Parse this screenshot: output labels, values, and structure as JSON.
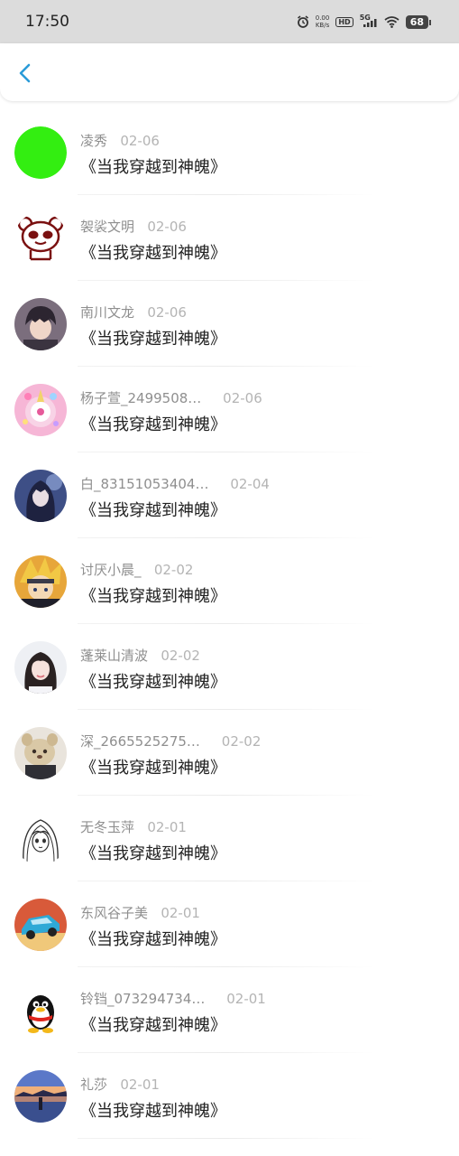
{
  "status_bar": {
    "time": "17:50",
    "net_speed_value": "0.00",
    "net_speed_unit": "KB/s",
    "hd": "HD",
    "network": "5G",
    "battery": "68",
    "icons": [
      "alarm-icon",
      "hd-icon",
      "signal-icon",
      "wifi-icon",
      "battery-icon"
    ]
  },
  "header": {
    "back_icon": "chevron-left-icon",
    "accent_color": "#2a9bd8"
  },
  "list": [
    {
      "name": "凌秀",
      "date": "02-06",
      "book": "《当我穿越到神魄》",
      "avatar": "green-circle"
    },
    {
      "name": "袈裟文明",
      "date": "02-06",
      "book": "《当我穿越到神魄》",
      "avatar": "panda-cartoon"
    },
    {
      "name": "南川文龙",
      "date": "02-06",
      "book": "《当我穿越到神魄》",
      "avatar": "anime-boy"
    },
    {
      "name": "杨子萱_2499508…",
      "date": "02-06",
      "book": "《当我穿越到神魄》",
      "avatar": "pink-unicorn"
    },
    {
      "name": "白_83151053404…",
      "date": "02-04",
      "book": "《当我穿越到神魄》",
      "avatar": "anime-girl-blue"
    },
    {
      "name": "讨厌小晨_",
      "date": "02-02",
      "book": "《当我穿越到神魄》",
      "avatar": "anime-orange"
    },
    {
      "name": "蓬莱山清波",
      "date": "02-02",
      "book": "《当我穿越到神魄》",
      "avatar": "girl-photo"
    },
    {
      "name": "深_2665525275…",
      "date": "02-02",
      "book": "《当我穿越到神魄》",
      "avatar": "plush-toy"
    },
    {
      "name": "无冬玉萍",
      "date": "02-01",
      "book": "《当我穿越到神魄》",
      "avatar": "sketch-girl"
    },
    {
      "name": "东风谷子美",
      "date": "02-01",
      "book": "《当我穿越到神魄》",
      "avatar": "blue-car"
    },
    {
      "name": "铃铛_073294734…",
      "date": "02-01",
      "book": "《当我穿越到神魄》",
      "avatar": "qq-penguin"
    },
    {
      "name": "礼莎",
      "date": "02-01",
      "book": "《当我穿越到神魄》",
      "avatar": "sunset-lake"
    }
  ]
}
